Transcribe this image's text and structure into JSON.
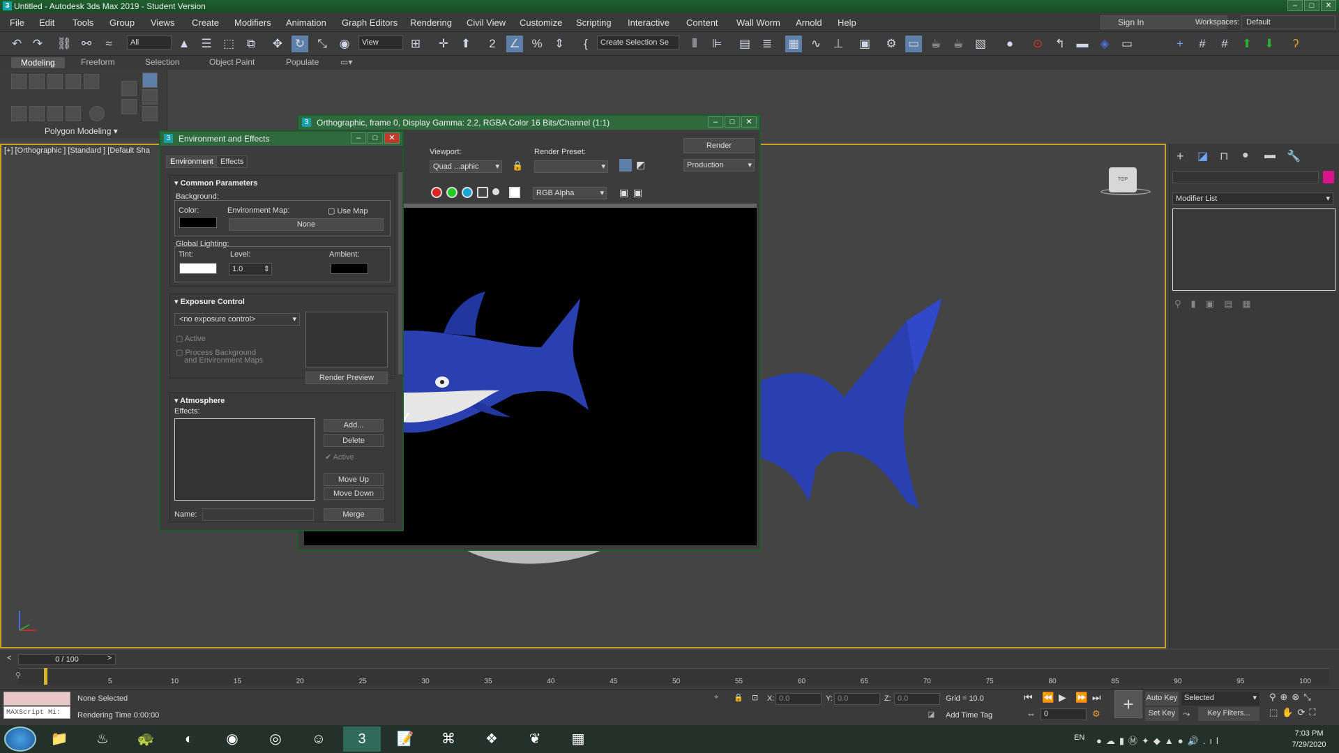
{
  "title": "Untitled - Autodesk 3ds Max 2019 - Student Version",
  "menu": [
    "File",
    "Edit",
    "Tools",
    "Group",
    "Views",
    "Create",
    "Modifiers",
    "Animation",
    "Graph Editors",
    "Rendering",
    "Civil View",
    "Customize",
    "Scripting",
    "Interactive",
    "Content",
    "Wall Worm",
    "Arnold",
    "Help"
  ],
  "sign_in": "Sign In",
  "workspaces_label": "Workspaces:",
  "workspace_value": "Default",
  "toolbar": {
    "filter": "All",
    "ref_coord": "View",
    "selection_set": "Create Selection Se"
  },
  "ribbon_tabs": [
    "Modeling",
    "Freeform",
    "Selection",
    "Object Paint",
    "Populate"
  ],
  "ribbon_label": "Polygon Modeling",
  "viewport_label": "[+] [Orthographic ] [Standard ] [Default Sha",
  "render_frame": {
    "title": "Orthographic, frame 0, Display Gamma: 2.2, RGBA Color 16 Bits/Channel (1:1)",
    "viewport_label": "Viewport:",
    "viewport_value": "Quad ...aphic",
    "render_preset_label": "Render Preset:",
    "render_preset_value": "",
    "render_button": "Render",
    "production": "Production",
    "channel": "RGB Alpha"
  },
  "env": {
    "title": "Environment and Effects",
    "tabs": [
      "Environment",
      "Effects"
    ],
    "common": "Common Parameters",
    "background": "Background:",
    "color": "Color:",
    "env_map": "Environment Map:",
    "use_map": "Use Map",
    "none": "None",
    "global_lighting": "Global Lighting:",
    "tint": "Tint:",
    "level": "Level:",
    "level_value": "1.0",
    "ambient": "Ambient:",
    "exposure": "Exposure Control",
    "no_exposure": "<no exposure control>",
    "active": "Active",
    "process_bg": "Process Background",
    "process_bg2": "and Environment Maps",
    "render_preview": "Render Preview",
    "atmosphere": "Atmosphere",
    "effects": "Effects:",
    "add": "Add...",
    "delete": "Delete",
    "active2": "Active",
    "move_up": "Move Up",
    "move_down": "Move Down",
    "name": "Name:",
    "merge": "Merge"
  },
  "command_panel": {
    "modifier_list": "Modifier List"
  },
  "timeline": {
    "slider": "0 / 100",
    "ticks": [
      "5",
      "10",
      "15",
      "20",
      "25",
      "30",
      "35",
      "40",
      "45",
      "50",
      "55",
      "60",
      "65",
      "70",
      "75",
      "80",
      "85",
      "90",
      "95",
      "100"
    ]
  },
  "status": {
    "none_selected": "None Selected",
    "rendering_time": "Rendering Time  0:00:00",
    "maxscript": "MAXScript Mi:",
    "x": "X:",
    "y": "Y:",
    "z": "Z:",
    "coord_val": "0.0",
    "grid": "Grid = 10.0",
    "add_time_tag": "Add Time Tag",
    "auto_key": "Auto Key",
    "selected": "Selected",
    "set_key": "Set Key",
    "key_filters": "Key Filters...",
    "frame": "0"
  },
  "taskbar": {
    "lang": "EN",
    "time": "7:03 PM",
    "date": "7/29/2020"
  },
  "colors": {
    "accent": "#c9a227",
    "title_green": "#2f6a3d",
    "shark_blue": "#2a3fb0"
  }
}
